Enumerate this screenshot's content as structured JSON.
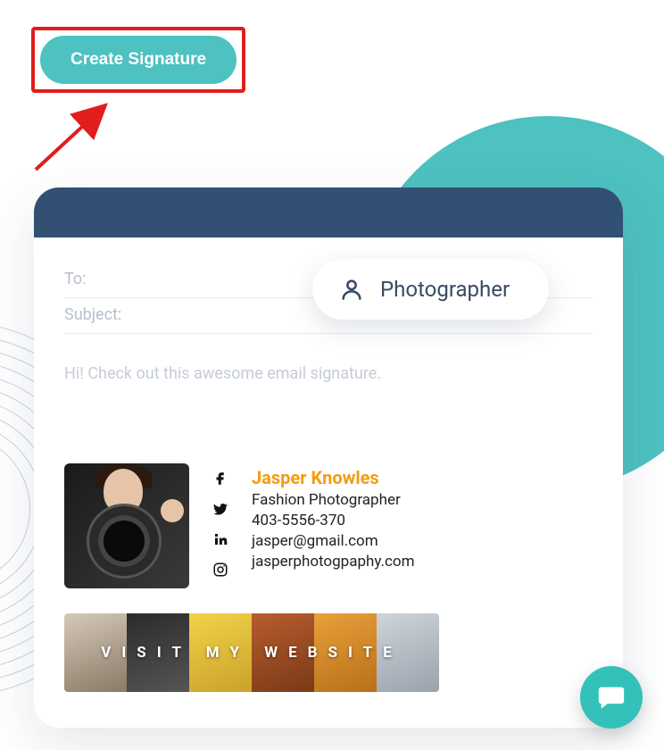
{
  "cta": {
    "label": "Create Signature"
  },
  "pill": {
    "label": "Photographer"
  },
  "email": {
    "to_label": "To:",
    "to_value": "",
    "subject_label": "Subject:",
    "subject_value": "",
    "body_text": "Hi! Check out this awesome email signature."
  },
  "signature": {
    "name": "Jasper Knowles",
    "title": "Fashion Photographer",
    "phone": "403-5556-370",
    "email": "jasper@gmail.com",
    "website": "jasperphotogpaphy.com",
    "banner_text": "VISIT MY WEBSITE"
  }
}
